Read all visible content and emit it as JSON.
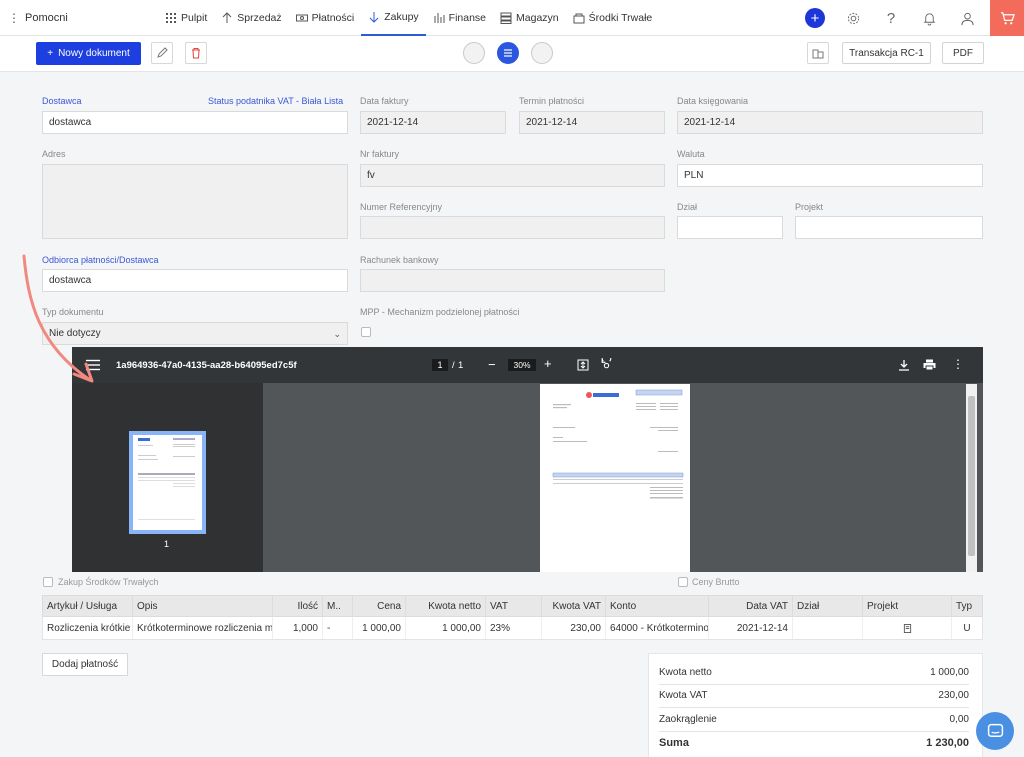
{
  "brand": {
    "name": "Pomocni"
  },
  "nav": {
    "items": [
      {
        "label": "Pulpit",
        "icon": "grid-icon"
      },
      {
        "label": "Sprzedaż",
        "icon": "arrow-up-icon"
      },
      {
        "label": "Płatności",
        "icon": "money-icon"
      },
      {
        "label": "Zakupy",
        "icon": "arrow-down-icon",
        "active": true
      },
      {
        "label": "Finanse",
        "icon": "chart-bars-icon"
      },
      {
        "label": "Magazyn",
        "icon": "warehouse-icon"
      },
      {
        "label": "Środki Trwałe",
        "icon": "building-icon"
      }
    ]
  },
  "toolbar": {
    "new_doc": "Nowy dokument",
    "transakcja": "Transakcja RC-1",
    "pdf": "PDF"
  },
  "form": {
    "dostawca_label": "Dostawca",
    "status_vat_label": "Status podatnika VAT - Biała Lista",
    "dostawca_value": "dostawca",
    "data_faktury_label": "Data faktury",
    "data_faktury_value": "2021-12-14",
    "termin_label": "Termin płatności",
    "termin_value": "2021-12-14",
    "data_ksieg_label": "Data księgowania",
    "data_ksieg_value": "2021-12-14",
    "adres_label": "Adres",
    "nr_faktury_label": "Nr faktury",
    "nr_faktury_value": "fv",
    "waluta_label": "Waluta",
    "waluta_value": "PLN",
    "numer_ref_label": "Numer Referencyjny",
    "dzial_label": "Dział",
    "projekt_label": "Projekt",
    "odbiorca_label": "Odbiorca płatności/Dostawca",
    "odbiorca_value": "dostawca",
    "rachunek_label": "Rachunek bankowy",
    "typ_doc_label": "Typ dokumentu",
    "typ_doc_value": "Nie dotyczy",
    "mpp_label": "MPP - Mechanizm podzielonej płatności"
  },
  "pdf": {
    "filename": "1a964936-47a0-4135-aa28-b64095ed7c5f",
    "page_current": "1",
    "page_sep": "/",
    "page_total": "1",
    "zoom": "30%",
    "thumb_num": "1"
  },
  "checks": {
    "zakup_st": "Zakup Środków Trwałych",
    "ceny_brutto": "Ceny Brutto"
  },
  "table": {
    "headers": [
      "Artykuł / Usługa",
      "Opis",
      "Ilość",
      "M..",
      "Cena",
      "Kwota netto",
      "VAT",
      "Kwota VAT",
      "Konto",
      "Data VAT",
      "Dział",
      "Projekt",
      "Typ"
    ],
    "rows": [
      [
        "Rozliczenia krótkie",
        "Krótkoterminowe rozliczenia mi",
        "1,000",
        "-",
        "1 000,00",
        "1 000,00",
        "23%",
        "230,00",
        "64000 - Krótkotermino",
        "2021-12-14",
        "",
        "",
        "U"
      ]
    ]
  },
  "add_payment": "Dodaj płatność",
  "summary": {
    "netto_label": "Kwota netto",
    "netto_value": "1 000,00",
    "vat_label": "Kwota VAT",
    "vat_value": "230,00",
    "zaokr_label": "Zaokrąglenie",
    "zaokr_value": "0,00",
    "suma_label": "Suma",
    "suma_value": "1 230,00"
  },
  "colors": {
    "accent": "#1d3fe0",
    "cart": "#f26b5b",
    "annotation_arrow": "#f08a80"
  }
}
